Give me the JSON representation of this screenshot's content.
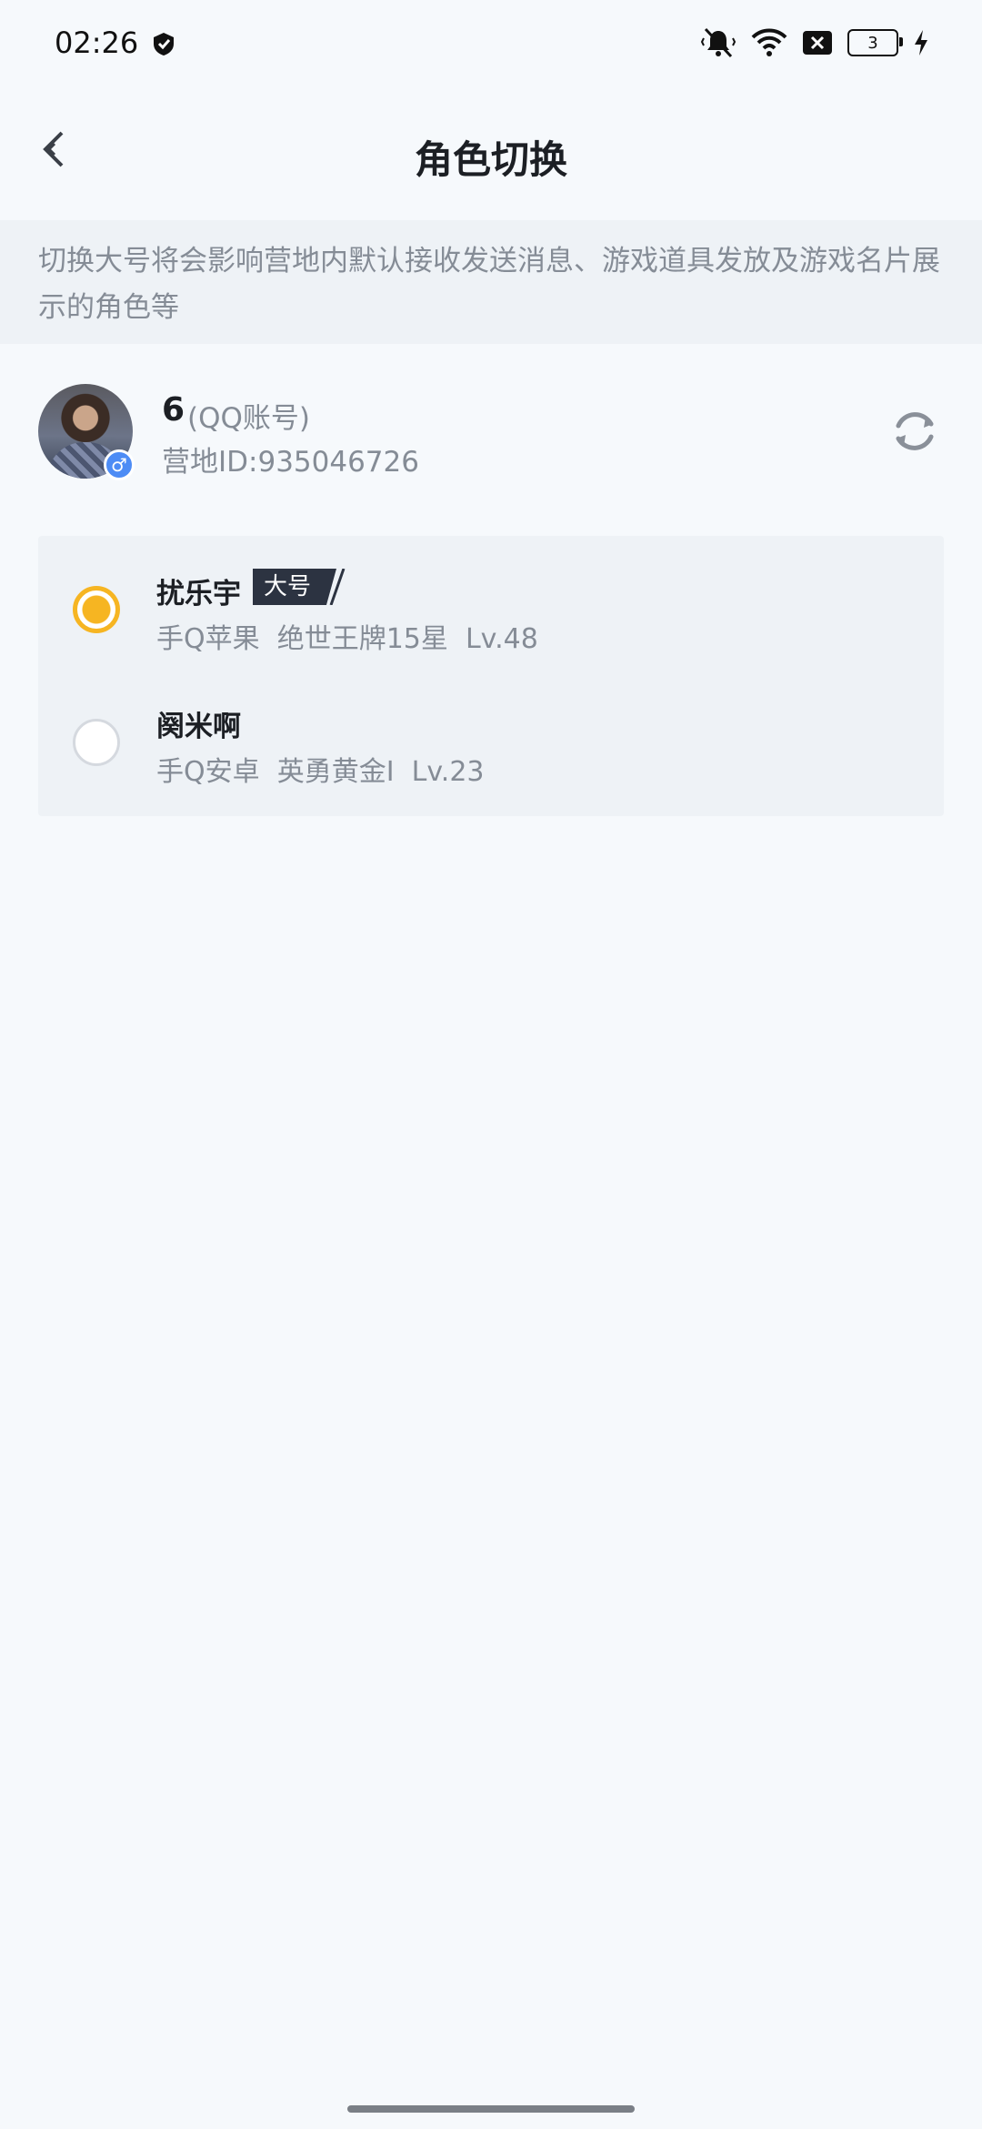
{
  "status_bar": {
    "time": "02:26",
    "battery": "3"
  },
  "header": {
    "title": "角色切换",
    "back_icon": "chevron-left-icon"
  },
  "notice": {
    "text": "切换大号将会影响营地内默认接收发送消息、游戏道具发放及游戏名片展示的角色等"
  },
  "account": {
    "name": "6",
    "type": "(QQ账号)",
    "camp_id_label": "营地ID:",
    "camp_id": "935046726",
    "gender_symbol": "♂",
    "refresh_icon": "refresh-icon"
  },
  "roles": [
    {
      "name": "扰乐宇",
      "tag": "大号",
      "selected": true,
      "platform": "手Q苹果",
      "rank": "绝世王牌15星",
      "level": "Lv.48"
    },
    {
      "name": "阕米啊",
      "tag": "",
      "selected": false,
      "platform": "手Q安卓",
      "rank": "英勇黄金I",
      "level": "Lv.23"
    }
  ],
  "colors": {
    "accent": "#f6b522",
    "page_bg": "#f6f9fc",
    "card_bg": "#eef2f6",
    "secondary_text": "#858c96"
  }
}
